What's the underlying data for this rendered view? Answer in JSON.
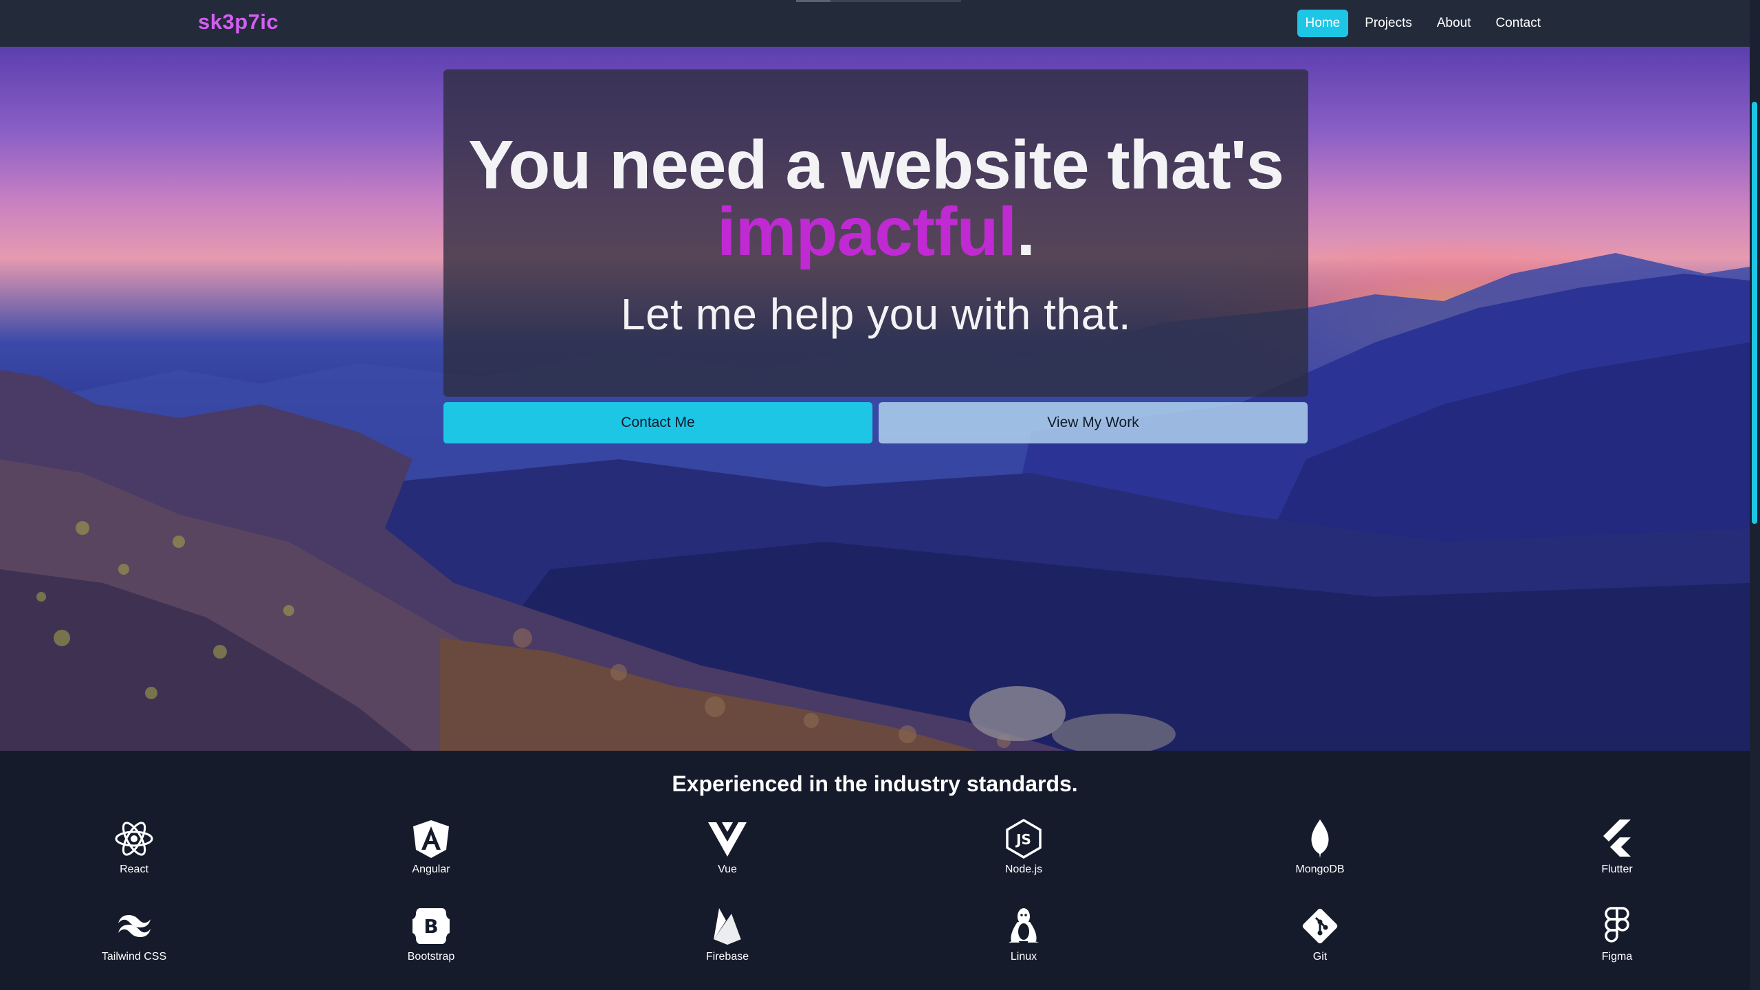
{
  "nav": {
    "brand": "sk3p7ic",
    "links": [
      {
        "label": "Home",
        "active": true
      },
      {
        "label": "Projects",
        "active": false
      },
      {
        "label": "About",
        "active": false
      },
      {
        "label": "Contact",
        "active": false
      }
    ]
  },
  "hero": {
    "headline_line1": "You need a website that's",
    "headline_accent": "impactful",
    "headline_period": ".",
    "subline": "Let me help you with that.",
    "contact_button": "Contact Me",
    "work_button": "View My Work"
  },
  "skills": {
    "title": "Experienced in the industry standards.",
    "items": [
      {
        "label": "React",
        "icon": "react-icon"
      },
      {
        "label": "Angular",
        "icon": "angular-icon"
      },
      {
        "label": "Vue",
        "icon": "vue-icon"
      },
      {
        "label": "Node.js",
        "icon": "nodejs-icon"
      },
      {
        "label": "MongoDB",
        "icon": "mongodb-icon"
      },
      {
        "label": "Flutter",
        "icon": "flutter-icon"
      },
      {
        "label": "Tailwind CSS",
        "icon": "tailwind-icon"
      },
      {
        "label": "Bootstrap",
        "icon": "bootstrap-icon"
      },
      {
        "label": "Firebase",
        "icon": "firebase-icon"
      },
      {
        "label": "Linux",
        "icon": "linux-icon"
      },
      {
        "label": "Git",
        "icon": "git-icon"
      },
      {
        "label": "Figma",
        "icon": "figma-icon"
      }
    ]
  },
  "colors": {
    "accent": "#1ec6e6",
    "brand": "#d45ef2",
    "headline_accent": "#c02ad2",
    "background": "#151b2b"
  }
}
